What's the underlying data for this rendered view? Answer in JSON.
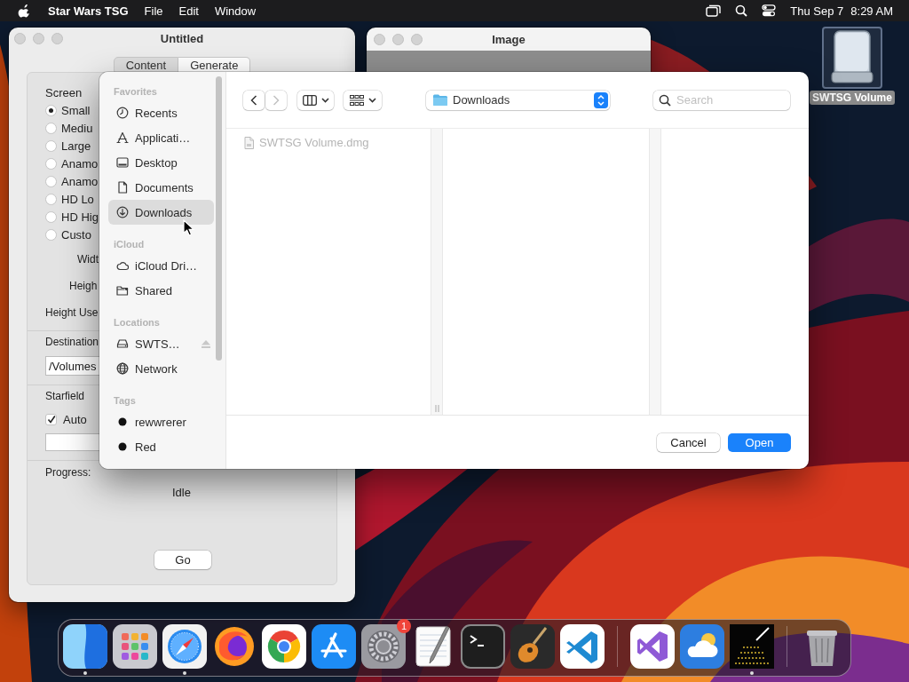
{
  "menu_bar": {
    "app_name": "Star Wars TSG",
    "menus": [
      "File",
      "Edit",
      "Window"
    ],
    "date": "Thu Sep 7",
    "time": "8:29 AM"
  },
  "untitled_window": {
    "title": "Untitled",
    "tabs": [
      {
        "label": "Content",
        "selected": false
      },
      {
        "label": "Generate",
        "selected": true
      }
    ],
    "screen_label": "Screen",
    "radios": [
      {
        "label": "Small",
        "selected": true
      },
      {
        "label": "Mediu",
        "selected": false
      },
      {
        "label": "Large",
        "selected": false
      },
      {
        "label": "Anamo",
        "selected": false
      },
      {
        "label": "Anamo",
        "selected": false
      },
      {
        "label": "HD Lo",
        "selected": false
      },
      {
        "label": "HD Hig",
        "selected": false
      },
      {
        "label": "Custo",
        "selected": false
      }
    ],
    "width_label": "Widt",
    "height_label": "Heigh",
    "height_used_label": "Height Use",
    "destination_label": "Destination",
    "destination_value": "/Volumes",
    "starfield_label": "Starfield",
    "auto_checkbox": {
      "label": "Auto",
      "checked": true
    },
    "progress_label": "Progress:",
    "status": "Idle",
    "go_button": "Go"
  },
  "image_window": {
    "title": "Image"
  },
  "desktop_icons": [
    {
      "label": "SWTSG Volume",
      "selected": true
    }
  ],
  "open_dialog": {
    "sidebar": [
      {
        "heading": "Favorites",
        "items": [
          {
            "kind": "place",
            "label": "Recents",
            "selected": false
          },
          {
            "kind": "place",
            "label": "Applicati…",
            "selected": false
          },
          {
            "kind": "place",
            "label": "Desktop",
            "selected": false
          },
          {
            "kind": "place",
            "label": "Documents",
            "selected": false
          },
          {
            "kind": "place",
            "label": "Downloads",
            "selected": true
          }
        ]
      },
      {
        "heading": "iCloud",
        "items": [
          {
            "kind": "place",
            "label": "iCloud Dri…",
            "selected": false
          },
          {
            "kind": "place",
            "label": "Shared",
            "selected": false
          }
        ]
      },
      {
        "heading": "Locations",
        "items": [
          {
            "kind": "place",
            "label": "SWTS…",
            "selected": false,
            "ejectable": true
          },
          {
            "kind": "place",
            "label": "Network",
            "selected": false,
            "ejectable": false
          }
        ]
      },
      {
        "heading": "Tags",
        "items": [
          {
            "kind": "tag",
            "label": "rewwrerer",
            "selected": false
          },
          {
            "kind": "tag",
            "label": "Red",
            "selected": false
          }
        ]
      }
    ],
    "toolbar": {
      "back": {
        "disabled": false
      },
      "forward": {
        "disabled": true
      },
      "location": "Downloads",
      "search_placeholder": "Search"
    },
    "files": [
      {
        "name": "SWTSG Volume.dmg",
        "disabled": true
      }
    ],
    "buttons": [
      {
        "label": "Cancel",
        "default": false
      },
      {
        "label": "Open",
        "default": true
      }
    ]
  },
  "dock": {
    "items": [
      {
        "kind": "app",
        "running": true
      },
      {
        "kind": "app",
        "running": false
      },
      {
        "kind": "app",
        "running": true
      },
      {
        "kind": "app",
        "running": false
      },
      {
        "kind": "app",
        "running": false
      },
      {
        "kind": "app",
        "running": false
      },
      {
        "kind": "app",
        "running": false,
        "badge": "1"
      },
      {
        "kind": "app",
        "running": false
      },
      {
        "kind": "app",
        "running": false
      },
      {
        "kind": "app",
        "running": false
      },
      {
        "kind": "app",
        "running": false
      },
      {
        "kind": "separator"
      },
      {
        "kind": "app",
        "running": false
      },
      {
        "kind": "app",
        "running": false
      },
      {
        "kind": "app",
        "running": true
      },
      {
        "kind": "separator"
      },
      {
        "kind": "app",
        "running": false
      }
    ]
  }
}
